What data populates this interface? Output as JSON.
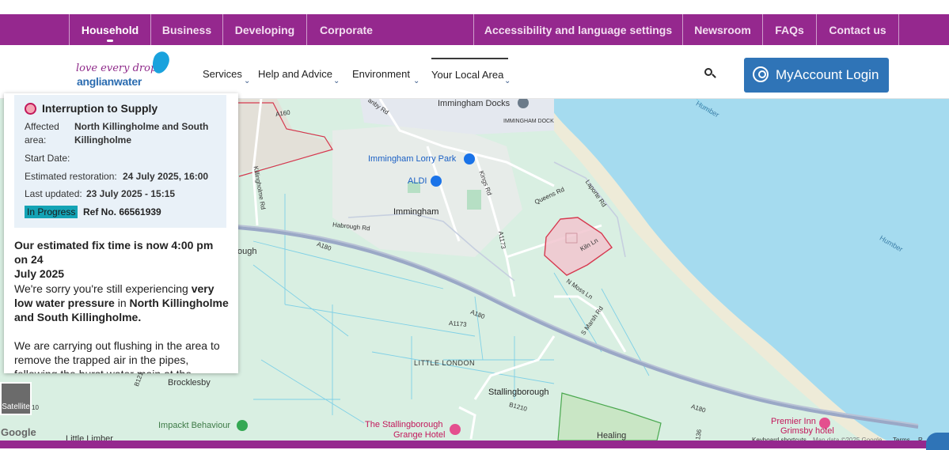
{
  "topnav": {
    "left_tabs": [
      "Household",
      "Business",
      "Developing",
      "Corporate"
    ],
    "right_tabs": [
      "Accessibility and language settings",
      "Newsroom",
      "FAQs",
      "Contact us"
    ],
    "active": "Household"
  },
  "logo": {
    "line1": "love every drop",
    "line2": "anglianwater"
  },
  "mainnav": {
    "items": [
      "Services",
      "Help and Advice",
      "Environment",
      "Your Local Area"
    ],
    "active": "Your Local Area"
  },
  "account": {
    "login_label": "MyAccount Login"
  },
  "incident": {
    "title": "Interruption to Supply",
    "affected_label": "Affected area:",
    "affected_label_1": "Affected",
    "affected_label_2": "area:",
    "affected_value_1": "North Killingholme and South",
    "affected_value_2": "Killingholme",
    "start_label": "Start Date:",
    "restoration_label": "Estimated restoration:",
    "restoration_value": "24 July 2025, 16:00",
    "updated_label": "Last updated:",
    "updated_value": "23 July 2025 - 15:15",
    "status": "In Progress",
    "ref": "Ref No. 66561939"
  },
  "message": {
    "headline_1": "Our estimated fix time is now 4:00 pm on 24",
    "headline_2": "July 2025",
    "p1_a": "We're sorry you're still experiencing ",
    "p1_b": "very",
    "p1_c": "low water pressure",
    "p1_d": " in ",
    "p1_e": "North Killingholme",
    "p1_f": "and South Killingholme.",
    "p2_1": "We are carrying out flushing in the area to",
    "p2_2": "remove the trapped air in the pipes,",
    "p2_3": "following the burst water main at the"
  },
  "map": {
    "labels": {
      "immingham_docks": "Immingham Docks",
      "immingham_dock": "IMMINGHAM DOCK",
      "lorry_park": "Immingham Lorry Park",
      "aldi": "ALDI",
      "immingham": "Immingham",
      "little_london": "LITTLE LONDON",
      "stallingborough": "Stallingborough",
      "brocklesby": "Brocklesby",
      "impackt": "Impackt Behaviour",
      "little_limber": "Little Limber",
      "stallingborough_hotel_1": "The Stallingborough",
      "stallingborough_hotel_2": "Grange Hotel",
      "premier_inn_1": "Premier Inn",
      "premier_inn_2": "Grimsby hotel",
      "healing": "Healing",
      "humber_1": "Humber",
      "humber_2": "Humber",
      "ough": "ough",
      "roads": {
        "a160": "A160",
        "a180_1": "A180",
        "a180_2": "A180",
        "a180_3": "A180",
        "a1173_1": "A1173",
        "a1173_2": "A1173",
        "habrough": "Habrough Rd",
        "kings": "Kings Rd",
        "queens": "Queens Rd",
        "laporte": "Laporte Rd",
        "kiln": "Kiln Ln",
        "moss": "N Moss Ln",
        "marsh": "S Marsh Rd",
        "killingholme": "Killingholme Rd",
        "b1210": "B1210",
        "b1211": "B121",
        "r136": "136",
        "anby": "anby Rd",
        "r10": "10"
      }
    },
    "satellite_label": "Satellite",
    "google": "Google",
    "footer": [
      "Keyboard shortcuts",
      "Map data ©2025 Google",
      "Terms",
      "R"
    ],
    "colors": {
      "land": "#d9efe2",
      "sea": "#a5dbef",
      "beach": "#eeebd8",
      "road": "#9aa8c6",
      "incident_fill": "#f1c6cf",
      "incident_stroke": "#d6394f"
    }
  },
  "colors": {
    "brand": "#95288e",
    "button": "#2f74b7",
    "card": "#e9f1f8",
    "badge": "#13a3b5"
  }
}
